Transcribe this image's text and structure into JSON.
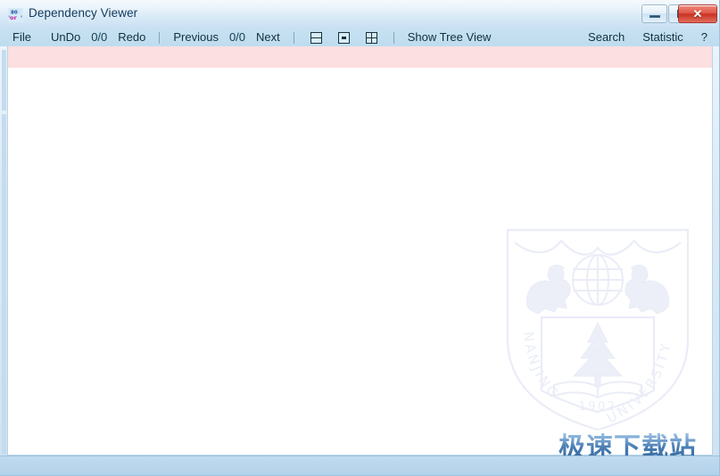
{
  "window": {
    "title": "Dependency Viewer",
    "icon": "app-icon",
    "controls": {
      "minimize_label": "–",
      "maximize_label": "□",
      "close_label": "✕",
      "minimize_name": "minimize",
      "maximize_name": "maximize",
      "close_name": "close"
    },
    "colors": {
      "titlebar_top": "#f4f9fd",
      "titlebar_bottom": "#c9e0f2",
      "menubar": "#c2deef",
      "close_button": "#c72f20",
      "highlight_band": "#fcdfe1",
      "client_background": "#ffffff",
      "status_bar": "#b3d2ea",
      "border": "#9dc3de",
      "text": "#10303f"
    }
  },
  "menu": {
    "file": "File",
    "undo": "UnDo",
    "undo_counter": "0/0",
    "redo": "Redo",
    "previous": "Previous",
    "nav_counter": "0/0",
    "next": "Next",
    "layout_icons": [
      {
        "name": "split-horizontal-icon",
        "title": "Split Horizontal"
      },
      {
        "name": "single-pane-icon",
        "title": "Single Pane"
      },
      {
        "name": "tile-grid-icon",
        "title": "Tile Grid"
      }
    ],
    "show_tree_view": "Show Tree View",
    "search": "Search",
    "statistic": "Statistic",
    "help": "?"
  },
  "content": {
    "highlight_band_text": "",
    "canvas_text": ""
  },
  "watermarks": {
    "crest": {
      "name": "nanjing-university-crest",
      "year": "1902",
      "left_text": "NANJING",
      "right_text": "UNIVERSITY"
    },
    "site": {
      "text": "极速下载站",
      "color_top": "#9dc3e6",
      "color_bottom": "#2f5f95"
    }
  },
  "status": {
    "text": ""
  }
}
